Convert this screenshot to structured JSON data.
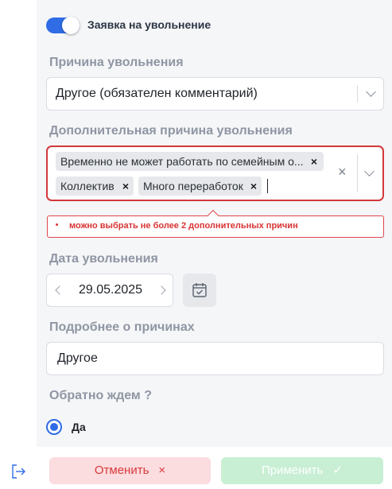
{
  "toggle": {
    "label": "Заявка на увольнение",
    "on": true
  },
  "reason": {
    "label": "Причина увольнения",
    "value": "Другое (обязателен комментарий)"
  },
  "extra_reason": {
    "label": "Дополнительная причина увольнения",
    "tags": [
      "Временно не может работать по семейным о...",
      "Коллектив",
      "Много переработок"
    ],
    "error": "можно выбрать не более 2 дополнительных причин"
  },
  "date": {
    "label": "Дата увольнения",
    "value": "29.05.2025"
  },
  "details": {
    "label": "Подробнее о причинах",
    "value": "Другое"
  },
  "wait_back": {
    "label": "Обратно ждем ?",
    "option": "Да",
    "selected": true
  },
  "footer": {
    "cancel_label": "Отменить",
    "cancel_icon": "×",
    "apply_label": "Применить",
    "apply_icon": "✓"
  },
  "colors": {
    "accent": "#2f6ce5",
    "error": "#d93a3a",
    "cancel_bg": "#fbdcdf",
    "apply_bg": "#c8efd4"
  }
}
